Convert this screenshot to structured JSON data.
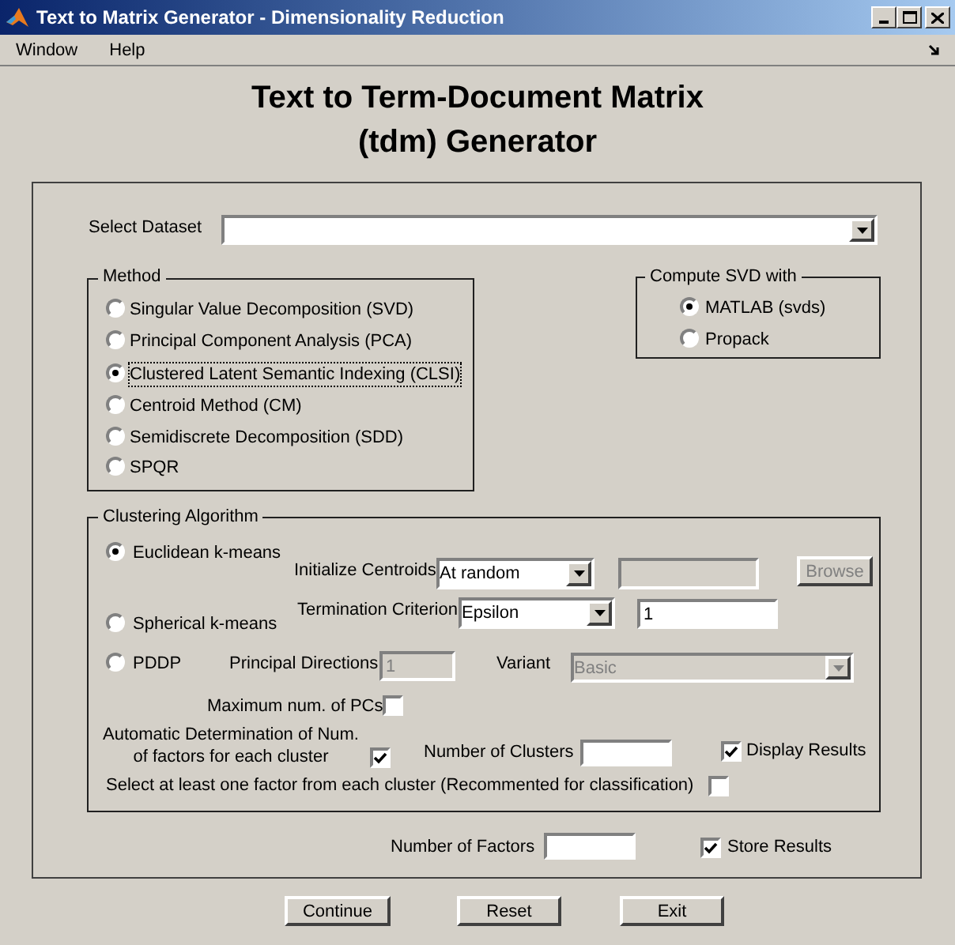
{
  "window": {
    "title": "Text to Matrix Generator - Dimensionality Reduction"
  },
  "menu": [
    "Window",
    "Help"
  ],
  "heading": [
    "Text to Term-Document Matrix",
    "(tdm) Generator"
  ],
  "select_dataset": {
    "label": "Select Dataset"
  },
  "method": {
    "title": "Method",
    "options": [
      {
        "label": "Singular Value Decomposition (SVD)",
        "selected": false,
        "focused": false
      },
      {
        "label": "Principal Component Analysis (PCA)",
        "selected": false,
        "focused": false
      },
      {
        "label": "Clustered Latent Semantic Indexing (CLSI)",
        "selected": true,
        "focused": true
      },
      {
        "label": "Centroid Method (CM)",
        "selected": false,
        "focused": false
      },
      {
        "label": "Semidiscrete Decomposition (SDD)",
        "selected": false,
        "focused": false
      },
      {
        "label": "SPQR",
        "selected": false,
        "focused": false
      }
    ]
  },
  "compute_svd": {
    "title": "Compute SVD with",
    "options": [
      {
        "label": "MATLAB (svds)",
        "selected": true
      },
      {
        "label": "Propack",
        "selected": false
      }
    ]
  },
  "clustering": {
    "title": "Clustering Algorithm",
    "algorithms": [
      {
        "label": "Euclidean k-means",
        "selected": true
      },
      {
        "label": "Spherical k-means",
        "selected": false
      },
      {
        "label": "PDDP",
        "selected": false
      }
    ],
    "initialize_centroids": {
      "label": "Initialize Centroids",
      "value": "At random",
      "file_field_disabled": true,
      "browse": {
        "label": "Browse",
        "disabled": true
      }
    },
    "termination_criterion": {
      "label": "Termination Criterion",
      "value": "Epsilon",
      "field_value": "1"
    },
    "principal_directions": {
      "label": "Principal Directions",
      "value": "1",
      "disabled": true
    },
    "variant": {
      "label": "Variant",
      "value": "Basic",
      "disabled": true
    },
    "max_pcs": {
      "label": "Maximum num. of PCs",
      "checked": false
    },
    "auto_determination": {
      "label_lines": [
        "Automatic Determination of Num.",
        "of factors for each cluster"
      ],
      "checked": true
    },
    "number_of_clusters": {
      "label": "Number of Clusters"
    },
    "display_results": {
      "label": "Display Results",
      "checked": true
    },
    "select_one_factor": {
      "label": "Select at least one factor from each cluster (Recommented for classification)",
      "checked": false
    }
  },
  "number_of_factors": {
    "label": "Number of Factors"
  },
  "store_results": {
    "label": "Store Results",
    "checked": true
  },
  "buttons": [
    "Continue",
    "Reset",
    "Exit"
  ]
}
